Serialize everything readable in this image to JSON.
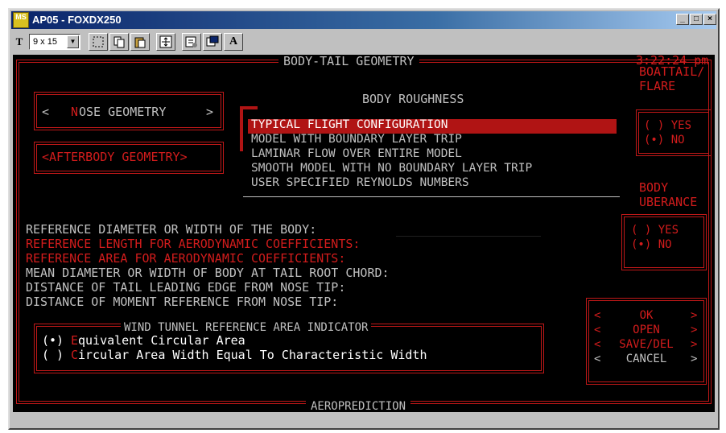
{
  "window": {
    "icon_text": "MS",
    "title": "AP05 - FOXDX250",
    "controls": [
      "_",
      "□",
      "×"
    ]
  },
  "toolbar": {
    "font_icon": "T",
    "font_size": "9 x 15",
    "dropdown_arrow": "▼",
    "bold_icon": "A"
  },
  "screen": {
    "title": "BODY-TAIL GEOMETRY",
    "time": "3:22:24 pm",
    "bottom_title": "AEROPREDICTION",
    "nose_button": {
      "left": "<",
      "prefix": " ",
      "hot": "N",
      "rest": "OSE GEOMETRY",
      "right": ">"
    },
    "afterbody_button": "<AFTERBODY GEOMETRY>",
    "roughness_label": "BODY ROUGHNESS",
    "roughness_options": [
      "TYPICAL FLIGHT CONFIGURATION",
      "MODEL WITH BOUNDARY LAYER TRIP",
      "LAMINAR FLOW OVER ENTIRE MODEL",
      "SMOOTH MODEL WITH NO BOUNDARY LAYER TRIP",
      "USER SPECIFIED REYNOLDS NUMBERS"
    ],
    "boattail": {
      "label_line1": "BOATTAIL/",
      "label_line2": "FLARE",
      "yes": "( ) YES",
      "no": "(•) NO"
    },
    "protuberance": {
      "label_line1": "BODY",
      "label_line2": "UBERANCE",
      "yes": "( ) YES",
      "no": "(•) NO"
    },
    "fields": [
      {
        "label": "REFERENCE DIAMETER OR WIDTH OF THE BODY:",
        "color": "gray"
      },
      {
        "label": "REFERENCE LENGTH FOR AERODYNAMIC COEFFICIENTS:",
        "color": "red"
      },
      {
        "label": "REFERENCE AREA FOR AERODYNAMIC COEFFICIENTS:",
        "color": "red"
      },
      {
        "label": "MEAN DIAMETER OR WIDTH OF BODY AT TAIL ROOT CHORD:",
        "color": "gray"
      },
      {
        "label": "DISTANCE OF TAIL LEADING EDGE FROM NOSE TIP:",
        "color": "gray"
      },
      {
        "label": "DISTANCE OF MOMENT REFERENCE FROM NOSE TIP:",
        "color": "gray"
      }
    ],
    "wind_tunnel": {
      "title": "WIND TUNNEL REFERENCE AREA INDICATOR",
      "opt1_mark": "(•)",
      "opt1_hot": "E",
      "opt1_rest": "quivalent Circular Area",
      "opt2_mark": "( )",
      "opt2_hot": "C",
      "opt2_rest": "ircular Area Width Equal To Characteristic Width"
    },
    "actions": [
      {
        "left": "<",
        "label": "OK",
        "right": ">"
      },
      {
        "left": "<",
        "label": "OPEN",
        "right": ">"
      },
      {
        "left": "<",
        "label": "SAVE/DEL",
        "right": ">"
      },
      {
        "left": "<",
        "label": "CANCEL",
        "right": ">"
      }
    ]
  },
  "colors": {
    "console_bg": "#000000",
    "accent_red": "#c01818",
    "text_gray": "#c0c0c0",
    "selection_red": "#b01414",
    "titlebar_blue": "#0a246a"
  }
}
